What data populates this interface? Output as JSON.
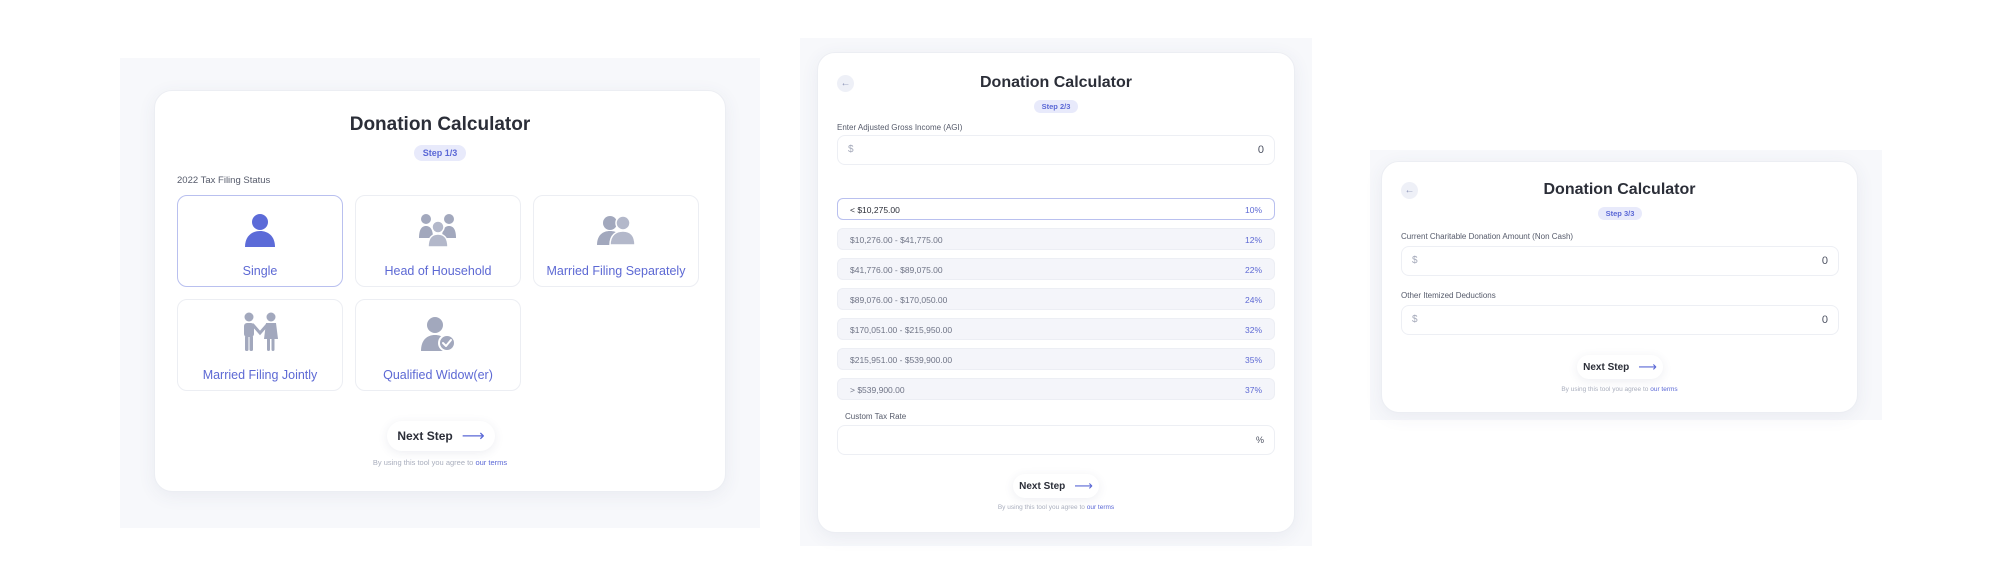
{
  "app_title": "Donation Calculator",
  "step1": {
    "badge": "Step 1/3",
    "section_label": "2022 Tax Filing Status",
    "options": [
      {
        "label": "Single",
        "icon": "single-person-icon",
        "selected": true
      },
      {
        "label": "Head of Household",
        "icon": "household-group-icon",
        "selected": false
      },
      {
        "label": "Married Filing Separately",
        "icon": "two-people-icon",
        "selected": false
      },
      {
        "label": "Married Filing Jointly",
        "icon": "couple-holding-hands-icon",
        "selected": false
      },
      {
        "label": "Qualified Widow(er)",
        "icon": "person-check-icon",
        "selected": false
      }
    ],
    "next_label": "Next Step",
    "terms_text": "By using this tool you agree to",
    "terms_link": "our terms"
  },
  "step2": {
    "badge": "Step 2/3",
    "back_icon": "←",
    "agi_label": "Enter Adjusted Gross Income (AGI)",
    "agi_prefix": "$",
    "agi_value": "0",
    "brackets": [
      {
        "range": "< $10,275.00",
        "rate": "10%",
        "selected": true
      },
      {
        "range": "$10,276.00 - $41,775.00",
        "rate": "12%",
        "selected": false
      },
      {
        "range": "$41,776.00 - $89,075.00",
        "rate": "22%",
        "selected": false
      },
      {
        "range": "$89,076.00 - $170,050.00",
        "rate": "24%",
        "selected": false
      },
      {
        "range": "$170,051.00 - $215,950.00",
        "rate": "32%",
        "selected": false
      },
      {
        "range": "$215,951.00 - $539,900.00",
        "rate": "35%",
        "selected": false
      },
      {
        "range": "> $539,900.00",
        "rate": "37%",
        "selected": false
      }
    ],
    "custom_label": "Custom Tax Rate",
    "custom_suffix": "%",
    "custom_value": "",
    "next_label": "Next Step",
    "terms_text": "By using this tool you agree to",
    "terms_link": "our terms"
  },
  "step3": {
    "badge": "Step 3/3",
    "back_icon": "←",
    "donation_label": "Current Charitable Donation Amount (Non Cash)",
    "donation_prefix": "$",
    "donation_value": "0",
    "deductions_label": "Other Itemized Deductions",
    "deductions_prefix": "$",
    "deductions_value": "0",
    "next_label": "Next Step",
    "terms_text": "By using this tool you agree to",
    "terms_link": "our terms"
  },
  "colors": {
    "accent": "#5b68d6",
    "icon_selected": "#5c6bd8",
    "icon_default": "#a2a8bd",
    "badge_bg": "#e8eafb"
  }
}
